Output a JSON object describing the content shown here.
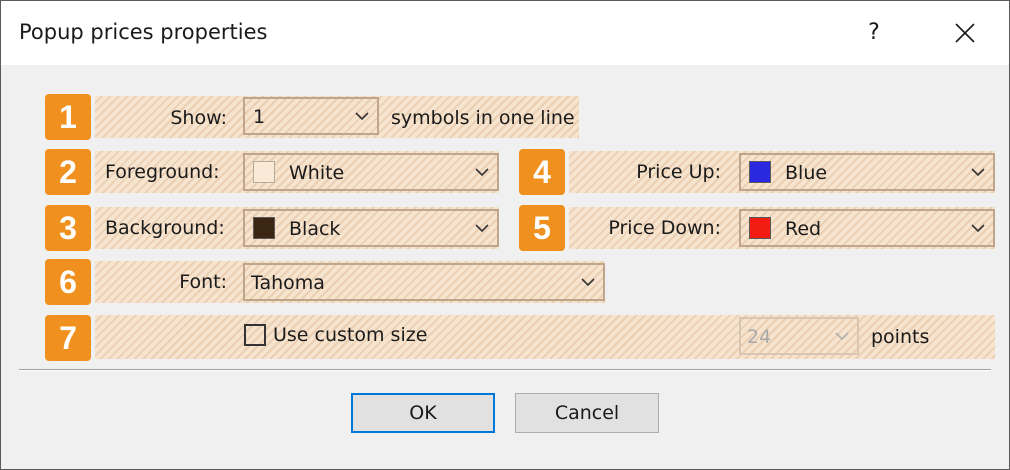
{
  "dialog": {
    "title": "Popup prices properties",
    "help_label": "?",
    "ok_label": "OK",
    "cancel_label": "Cancel"
  },
  "badges": [
    "1",
    "2",
    "3",
    "4",
    "5",
    "6",
    "7"
  ],
  "show": {
    "label": "Show:",
    "value": "1",
    "suffix": "symbols in one line"
  },
  "foreground": {
    "label": "Foreground:",
    "value": "White",
    "color": "#ffffff"
  },
  "background": {
    "label": "Background:",
    "value": "Black",
    "color": "#000000"
  },
  "price_up": {
    "label": "Price Up:",
    "value": "Blue",
    "color": "#0000ff"
  },
  "price_down": {
    "label": "Price Down:",
    "value": "Red",
    "color": "#ff0000"
  },
  "font": {
    "label": "Font:",
    "value": "Tahoma"
  },
  "custom_size": {
    "checkbox_label": "Use custom size",
    "checked": false,
    "value": "24",
    "units": "points"
  },
  "accent_colors": {
    "badge": "#f0911f",
    "highlight": "#f7e4cf",
    "default_button_border": "#0078d7"
  }
}
